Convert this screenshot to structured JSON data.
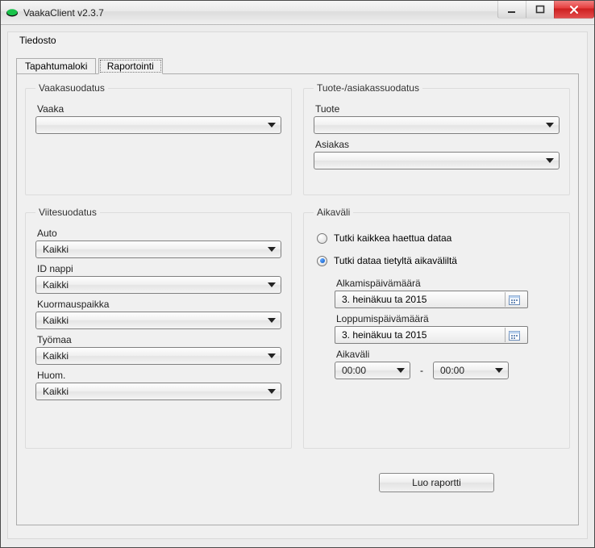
{
  "window": {
    "title": "VaakaClient v2.3.7"
  },
  "menu": {
    "file": "Tiedosto"
  },
  "tabs": {
    "event_log": "Tapahtumaloki",
    "reporting": "Raportointi"
  },
  "groups": {
    "scale_filter": "Vaakasuodatus",
    "product_customer_filter": "Tuote-/asiakassuodatus",
    "reference_filter": "Viitesuodatus",
    "time_range": "Aikaväli"
  },
  "labels": {
    "scale": "Vaaka",
    "product": "Tuote",
    "customer": "Asiakas",
    "vehicle": "Auto",
    "id_button": "ID nappi",
    "loading_site": "Kuormauspaikka",
    "worksite": "Työmaa",
    "note": "Huom.",
    "start_date": "Alkamispäivämäärä",
    "end_date": "Loppumispäivämäärä",
    "time_range": "Aikaväli"
  },
  "values": {
    "all": "Kaikki",
    "empty": "",
    "start_date": "3.  heinäkuu   ta 2015",
    "end_date": "3.  heinäkuu   ta 2015",
    "time_from": "00:00",
    "time_to": "00:00",
    "dash": "-"
  },
  "radios": {
    "all_data": "Tutki kaikkea haettua dataa",
    "range_data": "Tutki dataa tietyltä aikaväliltä",
    "selected": "range_data"
  },
  "buttons": {
    "create_report": "Luo raportti"
  },
  "icons": {
    "app": "app-icon",
    "minimize": "minimize-icon",
    "maximize": "maximize-icon",
    "close": "close-icon",
    "calendar": "calendar-icon",
    "dropdown": "chevron-down-icon"
  }
}
